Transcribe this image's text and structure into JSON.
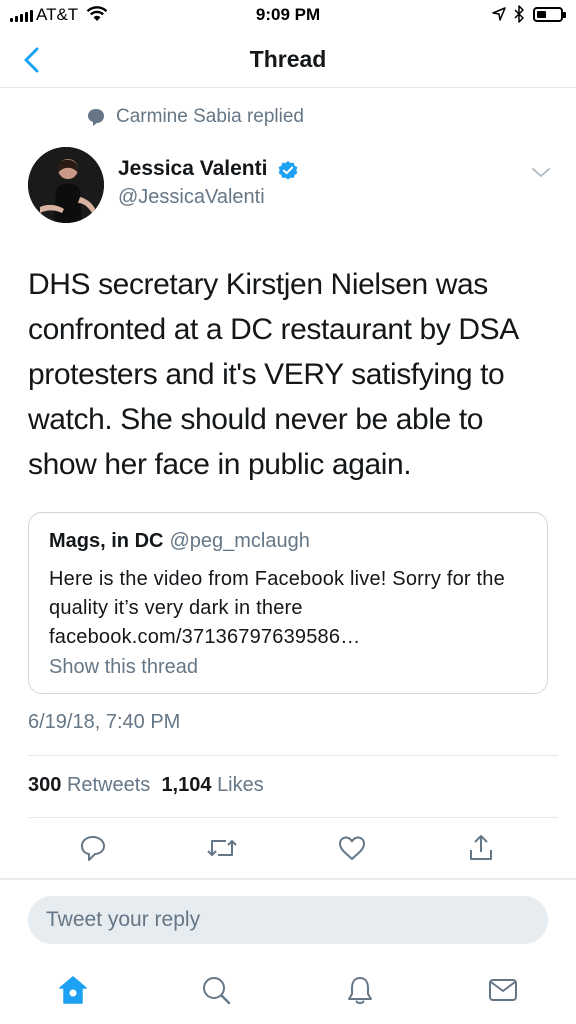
{
  "status_bar": {
    "carrier": "AT&T",
    "time": "9:09 PM"
  },
  "nav": {
    "title": "Thread",
    "back_icon": "chevron-left-icon"
  },
  "context": {
    "text": "Carmine Sabia replied",
    "icon": "reply-bubble-icon"
  },
  "tweet": {
    "author_name": "Jessica Valenti",
    "author_handle": "@JessicaValenti",
    "verified": true,
    "text": "DHS secretary Kirstjen Nielsen was confronted at a DC restaurant by DSA protesters and it's VERY satisfying to watch. She should never be able to show her face in public again.",
    "timestamp": "6/19/18, 7:40 PM",
    "retweets_count": "300",
    "retweets_label": "Retweets",
    "likes_count": "1,104",
    "likes_label": "Likes"
  },
  "quote": {
    "name": "Mags, in DC",
    "handle": "@peg_mclaugh",
    "text": "Here is the video from Facebook live! Sorry for the quality it’s very dark in there facebook.com/37136797639586…",
    "link": "Show this thread"
  },
  "actions": [
    "reply-icon",
    "retweet-icon",
    "like-icon",
    "share-icon"
  ],
  "reply": {
    "placeholder": "Tweet your reply"
  },
  "tabbar": [
    "home-icon",
    "search-icon",
    "notifications-icon",
    "messages-icon"
  ],
  "colors": {
    "accent": "#1da1f2",
    "muted": "#657786",
    "text": "#14171a",
    "border": "#e1e8ed"
  }
}
